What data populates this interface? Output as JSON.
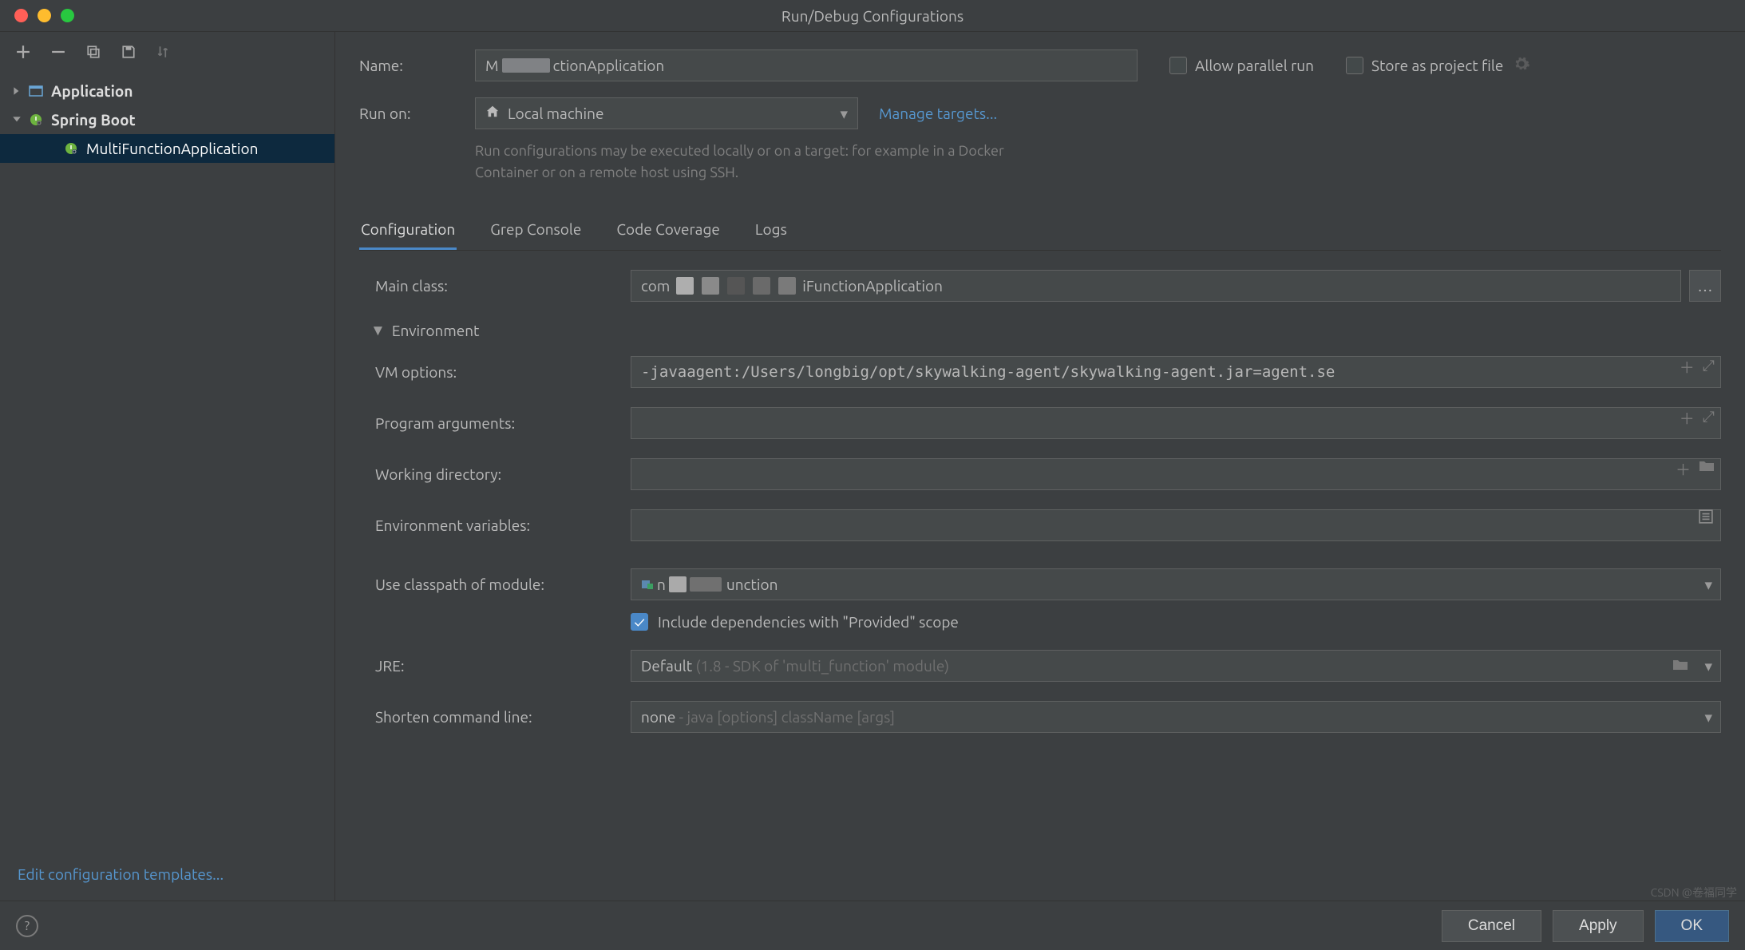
{
  "window": {
    "title": "Run/Debug Configurations"
  },
  "sidebar": {
    "items": [
      {
        "label": "Application",
        "expanded": false
      },
      {
        "label": "Spring Boot",
        "expanded": true,
        "children": [
          {
            "label": "MultiFunctionApplication",
            "selected": true
          }
        ]
      }
    ],
    "edit_templates": "Edit configuration templates..."
  },
  "form": {
    "name_label": "Name:",
    "name_value_prefix": "M",
    "name_value_suffix": "ctionApplication",
    "allow_parallel": "Allow parallel run",
    "store_project": "Store as project file",
    "run_on_label": "Run on:",
    "run_on_value": "Local machine",
    "manage_targets": "Manage targets...",
    "run_on_help": "Run configurations may be executed locally or on a target: for example in a Docker Container or on a remote host using SSH."
  },
  "tabs": [
    "Configuration",
    "Grep Console",
    "Code Coverage",
    "Logs"
  ],
  "config": {
    "main_class_label": "Main class:",
    "main_class_prefix": "com",
    "main_class_suffix": "iFunctionApplication",
    "env_header": "Environment",
    "vm_label": "VM options:",
    "vm_value": "-javaagent:/Users/longbig/opt/skywalking-agent/skywalking-agent.jar=agent.se",
    "program_args_label": "Program arguments:",
    "working_dir_label": "Working directory:",
    "env_vars_label": "Environment variables:",
    "classpath_label": "Use classpath of module:",
    "classpath_prefix": "n",
    "classpath_suffix": "unction",
    "include_provided": "Include dependencies with \"Provided\" scope",
    "jre_label": "JRE:",
    "jre_value": "Default",
    "jre_hint": "(1.8 - SDK of 'multi_function' module)",
    "shorten_label": "Shorten command line:",
    "shorten_value": "none",
    "shorten_hint": "- java [options] className [args]"
  },
  "footer": {
    "cancel": "Cancel",
    "apply": "Apply",
    "ok": "OK"
  },
  "watermark": "CSDN @卷福同学"
}
